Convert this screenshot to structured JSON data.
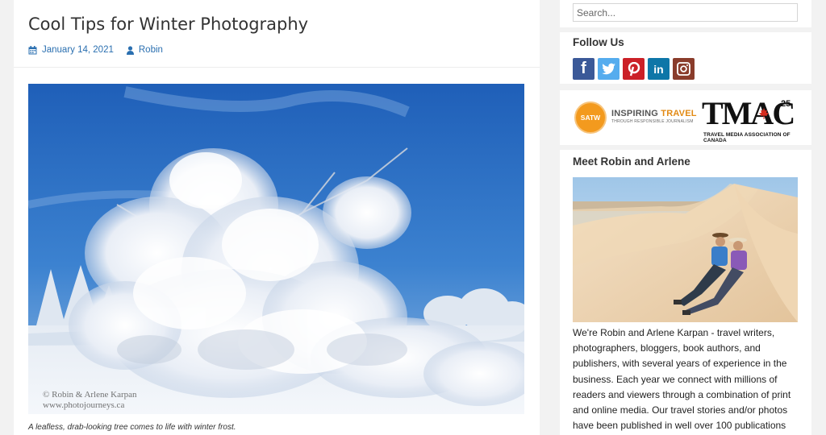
{
  "post": {
    "title": "Cool Tips for Winter Photography",
    "date": "January 14, 2021",
    "author": "Robin",
    "image_watermark_line1": "© Robin & Arlene Karpan",
    "image_watermark_line2": "www.photojourneys.ca",
    "caption": "A leafless, drab-looking tree comes to life with winter frost."
  },
  "sidebar": {
    "search_placeholder": "Search...",
    "follow_title": "Follow Us",
    "social_icons": [
      "facebook-icon",
      "twitter-icon",
      "pinterest-icon",
      "linkedin-icon",
      "instagram-icon"
    ],
    "satw_badge": "SATW",
    "satw_main_prefix": "INSPIRING ",
    "satw_main_highlight": "TRAVEL",
    "satw_sub": "THROUGH RESPONSIBLE JOURNALISM",
    "tmac_letters": "TMAC",
    "tmac_number": "25",
    "tmac_sub": "TRAVEL MEDIA ASSOCIATION OF CANADA",
    "meet_title": "Meet Robin and Arlene",
    "bio": "We're Robin and Arlene Karpan - travel writers, photographers, bloggers, book authors, and publishers, with several years of experience in the business. Each year we connect with millions of readers and viewers through a combination of print and online media. Our travel stories and/or photos have been published in well over 100 publications"
  },
  "colors": {
    "link_blue": "#2a6fb0",
    "facebook": "#3b5998",
    "twitter": "#55acee",
    "pinterest": "#cb2027",
    "linkedin": "#0e76a8",
    "instagram": "#8a3c2b",
    "satw_orange": "#f39a1e"
  }
}
